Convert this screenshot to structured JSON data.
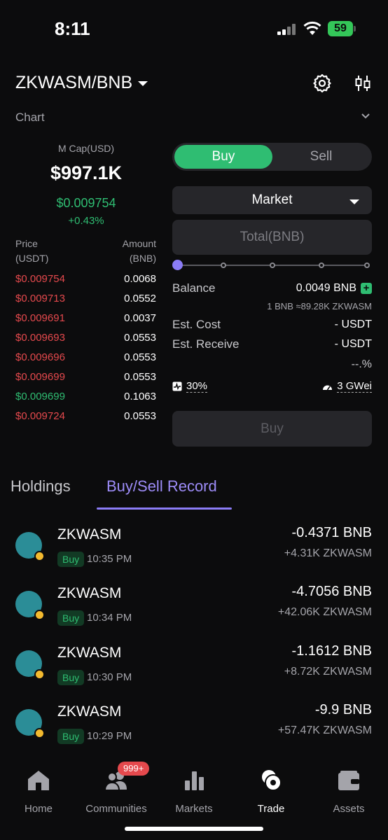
{
  "status_bar": {
    "time": "8:11",
    "battery": "59"
  },
  "header": {
    "pair": "ZKWASM/BNB",
    "chart_label": "Chart"
  },
  "market_info": {
    "mcap_label": "M Cap(USD)",
    "mcap_value": "$997.1K",
    "price": "$0.009754",
    "change": "+0.43%"
  },
  "order_book": {
    "price_header_1": "Price",
    "price_header_2": "(USDT)",
    "amount_header_1": "Amount",
    "amount_header_2": "(BNB)",
    "rows": [
      {
        "price": "$0.009754",
        "amount": "0.0068",
        "side": "sell"
      },
      {
        "price": "$0.009713",
        "amount": "0.0552",
        "side": "sell"
      },
      {
        "price": "$0.009691",
        "amount": "0.0037",
        "side": "sell"
      },
      {
        "price": "$0.009693",
        "amount": "0.0553",
        "side": "sell"
      },
      {
        "price": "$0.009696",
        "amount": "0.0553",
        "side": "sell"
      },
      {
        "price": "$0.009699",
        "amount": "0.0553",
        "side": "sell"
      },
      {
        "price": "$0.009699",
        "amount": "0.1063",
        "side": "buy"
      },
      {
        "price": "$0.009724",
        "amount": "0.0553",
        "side": "sell"
      }
    ]
  },
  "trade_form": {
    "buy_label": "Buy",
    "sell_label": "Sell",
    "order_type": "Market",
    "total_placeholder": "Total(BNB)",
    "slider_percent": 0,
    "balance_label": "Balance",
    "balance_value": "0.0049 BNB",
    "rate": "1 BNB ≈89.28K ZKWASM",
    "est_cost_label": "Est. Cost",
    "est_cost_value": "- USDT",
    "est_receive_label": "Est. Receive",
    "est_receive_value": "- USDT",
    "pct_value": "--.%",
    "slippage": "30%",
    "gas": "3 GWei",
    "submit_label": "Buy"
  },
  "tabs": {
    "holdings": "Holdings",
    "record": "Buy/Sell Record"
  },
  "records": [
    {
      "name": "ZKWASM",
      "side": "Buy",
      "time": "10:35 PM",
      "amount": "-0.4371 BNB",
      "qty": "+4.31K ZKWASM"
    },
    {
      "name": "ZKWASM",
      "side": "Buy",
      "time": "10:34 PM",
      "amount": "-4.7056 BNB",
      "qty": "+42.06K ZKWASM"
    },
    {
      "name": "ZKWASM",
      "side": "Buy",
      "time": "10:30 PM",
      "amount": "-1.1612 BNB",
      "qty": "+8.72K ZKWASM"
    },
    {
      "name": "ZKWASM",
      "side": "Buy",
      "time": "10:29 PM",
      "amount": "-9.9 BNB",
      "qty": "+57.47K ZKWASM"
    }
  ],
  "bottom_nav": {
    "home": "Home",
    "communities": "Communities",
    "communities_badge": "999+",
    "markets": "Markets",
    "trade": "Trade",
    "assets": "Assets"
  },
  "colors": {
    "accent_green": "#2fbd72",
    "accent_red": "#e5494d",
    "accent_purple": "#8b7cf6"
  }
}
